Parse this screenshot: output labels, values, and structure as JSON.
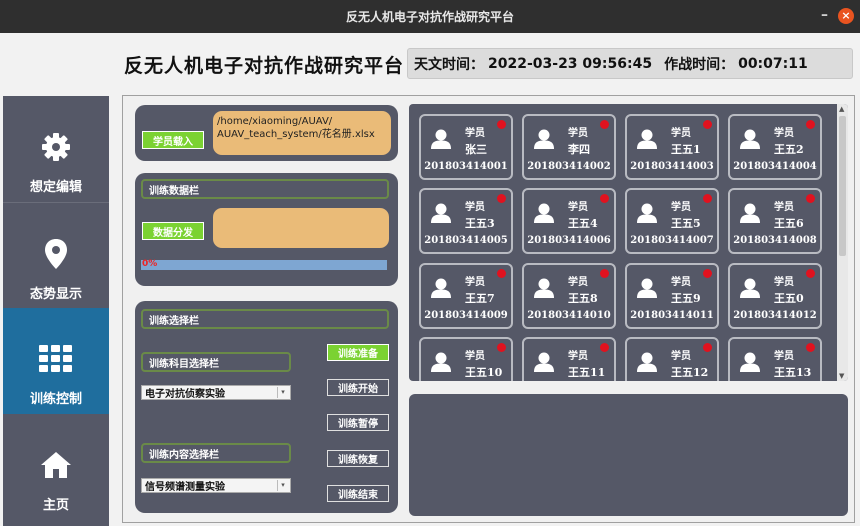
{
  "window": {
    "title": "反无人机电子对抗作战研究平台",
    "minimize": "–",
    "close": "×"
  },
  "header": {
    "app_title": "反无人机电子对抗作战研究平台",
    "astro_time_label": "天文时间：",
    "astro_time": "2022-03-23 09:56:45",
    "combat_time_label": "作战时间：",
    "combat_time": "00:07:11"
  },
  "sidebar": {
    "items": [
      {
        "label": "想定编辑",
        "icon": "gear-icon",
        "active": false
      },
      {
        "label": "态势显示",
        "icon": "location-pin-icon",
        "active": false
      },
      {
        "label": "训练控制",
        "icon": "grid-icon",
        "active": true
      },
      {
        "label": "主页",
        "icon": "home-icon",
        "active": false
      }
    ]
  },
  "load_panel": {
    "button": "学员载入",
    "file_path": "/home/xiaoming/AUAV/ AUAV_teach_system/花名册.xlsx"
  },
  "data_panel": {
    "title": "训练数据栏",
    "button": "数据分发",
    "progress_percent": 0,
    "progress_text": "0%"
  },
  "select_panel": {
    "title": "训练选择栏",
    "subject_label": "训练科目选择栏",
    "subject_value": "电子对抗侦察实验",
    "content_label": "训练内容选择栏",
    "content_value": "信号频谱测量实验",
    "buttons": {
      "prepare": "训练准备",
      "start": "训练开始",
      "pause": "训练暂停",
      "resume": "训练恢复",
      "end": "训练结束"
    }
  },
  "students": [
    {
      "role": "学员",
      "name": "张三",
      "id": "201803414001"
    },
    {
      "role": "学员",
      "name": "李四",
      "id": "201803414002"
    },
    {
      "role": "学员",
      "name": "王五1",
      "id": "201803414003"
    },
    {
      "role": "学员",
      "name": "王五2",
      "id": "201803414004"
    },
    {
      "role": "学员",
      "name": "王五3",
      "id": "201803414005"
    },
    {
      "role": "学员",
      "name": "王五4",
      "id": "201803414006"
    },
    {
      "role": "学员",
      "name": "王五5",
      "id": "201803414007"
    },
    {
      "role": "学员",
      "name": "王五6",
      "id": "201803414008"
    },
    {
      "role": "学员",
      "name": "王五7",
      "id": "201803414009"
    },
    {
      "role": "学员",
      "name": "王五8",
      "id": "201803414010"
    },
    {
      "role": "学员",
      "name": "王五9",
      "id": "201803414011"
    },
    {
      "role": "学员",
      "name": "王五0",
      "id": "201803414012"
    },
    {
      "role": "学员",
      "name": "王五10",
      "id": ""
    },
    {
      "role": "学员",
      "name": "王五11",
      "id": ""
    },
    {
      "role": "学员",
      "name": "王五12",
      "id": ""
    },
    {
      "role": "学员",
      "name": "王五13",
      "id": ""
    }
  ],
  "colors": {
    "panel": "#555867",
    "active_nav": "#1f6e9e",
    "green": "#7bd232",
    "orange": "#eabb78",
    "status_dot": "#e0121f"
  }
}
